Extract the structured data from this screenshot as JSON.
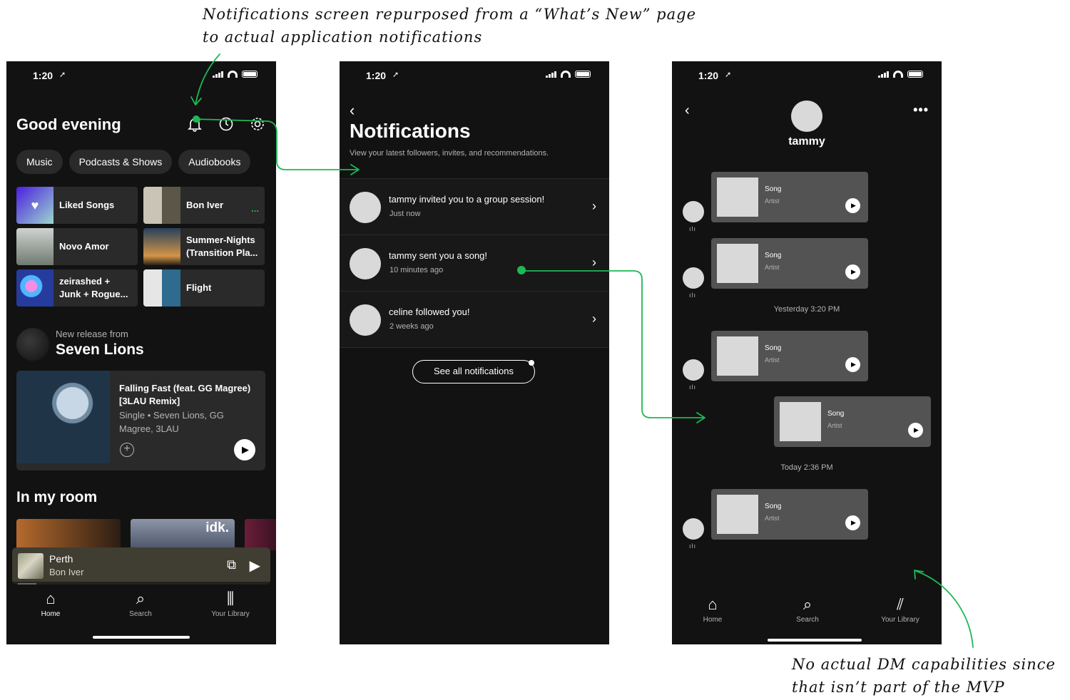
{
  "annotations": {
    "top": "Notifications screen repurposed from a “What’s New” page to actual application notifications",
    "bottom": "No actual DM capabilities since that isn’t part of the MVP"
  },
  "status": {
    "time": "1:20",
    "arrow": "➚"
  },
  "home": {
    "greeting": "Good evening",
    "chips": [
      "Music",
      "Podcasts & Shows",
      "Audiobooks"
    ],
    "shortcuts": [
      {
        "label": "Liked Songs"
      },
      {
        "label": "Bon Iver",
        "more": "..."
      },
      {
        "label": "Novo Amor"
      },
      {
        "label": "Summer-Nights (Transition Pla..."
      },
      {
        "label": "zeirashed + Junk + Rogue..."
      },
      {
        "label": "Flight"
      }
    ],
    "release_subtitle": "New release from",
    "release_artist": "Seven Lions",
    "release_card": {
      "title": "Falling Fast (feat. GG Magree) [3LAU Remix]",
      "meta": "Single • Seven Lions, GG Magree, 3LAU"
    },
    "room_title": "In my room",
    "room_tile_text": "idk.",
    "mini_player": {
      "title": "Perth",
      "artist": "Bon Iver"
    },
    "tabs": [
      "Home",
      "Search",
      "Your Library"
    ]
  },
  "notifications": {
    "title": "Notifications",
    "subtitle": "View your latest followers, invites, and recommendations.",
    "items": [
      {
        "text": "tammy invited you to a group session!",
        "time": "Just now"
      },
      {
        "text": "tammy sent you a song!",
        "time": "10 minutes ago"
      },
      {
        "text": "celine followed you!",
        "time": "2 weeks ago"
      }
    ],
    "see_all": "See all notifications"
  },
  "dm": {
    "name": "tammy",
    "more": "•••",
    "songs": [
      {
        "name": "Song",
        "artist": "Artist"
      },
      {
        "name": "Song",
        "artist": "Artist"
      },
      {
        "name": "Song",
        "artist": "Artist"
      },
      {
        "name": "Song",
        "artist": "Artist"
      },
      {
        "name": "Song",
        "artist": "Artist"
      }
    ],
    "timestamps": [
      "Yesterday 3:20 PM",
      "Today 2:36 PM"
    ],
    "tabs": [
      "Home",
      "Search",
      "Your Library"
    ]
  },
  "colors": {
    "accent": "#1db954",
    "background": "#121212",
    "card": "#2a2a2a"
  }
}
